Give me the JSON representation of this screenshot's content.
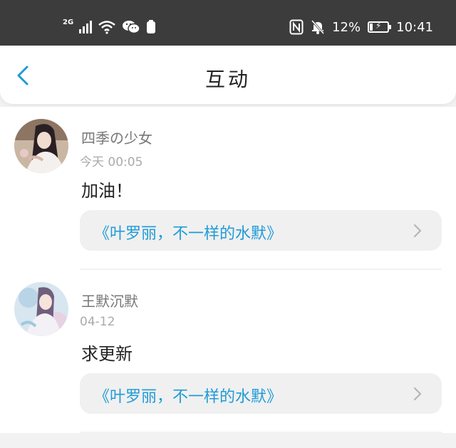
{
  "status_bar": {
    "network": "2G",
    "battery_percent": "12%",
    "time": "10:41",
    "battery_level": 0.12,
    "icons": [
      "signal-icon",
      "wifi-icon",
      "wechat-icon",
      "sim-icon",
      "nfc-icon",
      "mute-bell-icon",
      "battery-charging-icon"
    ]
  },
  "header": {
    "title": "互动",
    "back_icon": "chevron-left-icon"
  },
  "colors": {
    "accent": "#1e9bd7",
    "status_bar_bg": "#3c3c3c"
  },
  "feed": [
    {
      "username": "四季の少女",
      "time": "今天 00:05",
      "comment": "加油！",
      "story": "《叶罗丽，不一样的水默》"
    },
    {
      "username": "王默沉默",
      "time": "04-12",
      "comment": "求更新",
      "story": "《叶罗丽，不一样的水默》"
    }
  ]
}
